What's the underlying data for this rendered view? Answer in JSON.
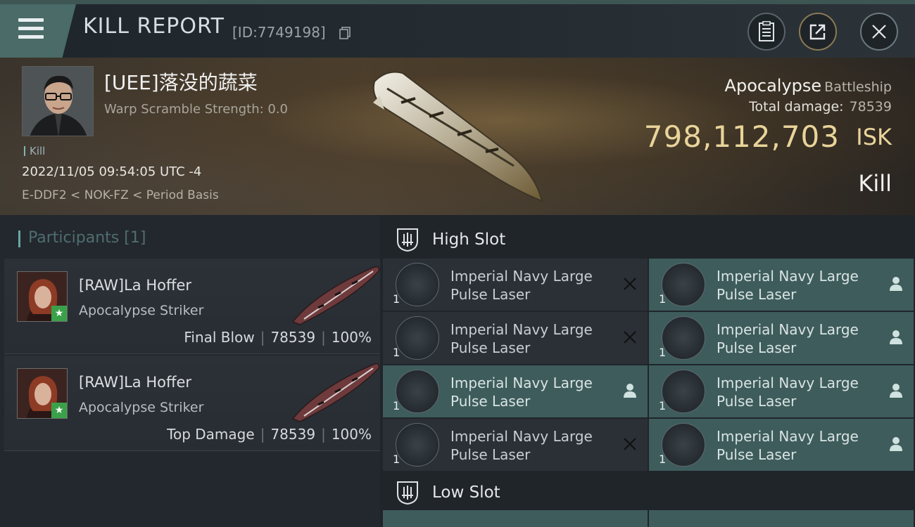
{
  "header": {
    "title": "KILL REPORT",
    "id_text": "[ID:7749198]"
  },
  "victim": {
    "name": "[UEE]落没的蔬菜",
    "warp_scramble": "Warp Scramble Strength: 0.0",
    "kill_tag": "Kill",
    "datetime": "2022/11/05 09:54:05 UTC -4",
    "location": "E-DDF2 < NOK-FZ < Period Basis"
  },
  "ship": {
    "name": "Apocalypse",
    "class": "Battleship",
    "total_damage_label": "Total damage:",
    "total_damage_value": "78539",
    "isk_value": "798,112,703",
    "isk_unit": "ISK",
    "result": "Kill"
  },
  "participants": {
    "label": "Participants",
    "count": "[1]",
    "items": [
      {
        "name": "[RAW]La Hoffer",
        "ship": "Apocalypse Striker",
        "role": "Final Blow",
        "damage": "78539",
        "percent": "100%"
      },
      {
        "name": "[RAW]La Hoffer",
        "ship": "Apocalypse Striker",
        "role": "Top Damage",
        "damage": "78539",
        "percent": "100%"
      }
    ]
  },
  "slots": {
    "high_label": "High Slot",
    "low_label": "Low Slot",
    "high_modules": [
      {
        "line1": "Imperial Navy Large",
        "line2": "Pulse Laser",
        "qty": "1",
        "status": "destroyed"
      },
      {
        "line1": "Imperial Navy Large",
        "line2": "Pulse Laser",
        "qty": "1",
        "status": "dropped"
      },
      {
        "line1": "Imperial Navy Large",
        "line2": "Pulse Laser",
        "qty": "1",
        "status": "destroyed"
      },
      {
        "line1": "Imperial Navy Large",
        "line2": "Pulse Laser",
        "qty": "1",
        "status": "dropped"
      },
      {
        "line1": "Imperial Navy Large",
        "line2": "Pulse Laser",
        "qty": "1",
        "status": "dropped"
      },
      {
        "line1": "Imperial Navy Large",
        "line2": "Pulse Laser",
        "qty": "1",
        "status": "dropped"
      },
      {
        "line1": "Imperial Navy Large",
        "line2": "Pulse Laser",
        "qty": "1",
        "status": "destroyed"
      },
      {
        "line1": "Imperial Navy Large",
        "line2": "Pulse Laser",
        "qty": "1",
        "status": "dropped"
      }
    ]
  },
  "colors": {
    "accent_teal": "#3e5c5c",
    "isk_gold": "#e9d49a",
    "badge_green": "#3aa14a"
  },
  "icons": {
    "menu": "hamburger-icon",
    "copy": "copy-icon",
    "clipboard": "clipboard-icon",
    "share": "share-icon",
    "close": "close-icon",
    "shield": "slot-shield-icon",
    "destroyed": "x-icon",
    "dropped": "person-icon"
  }
}
